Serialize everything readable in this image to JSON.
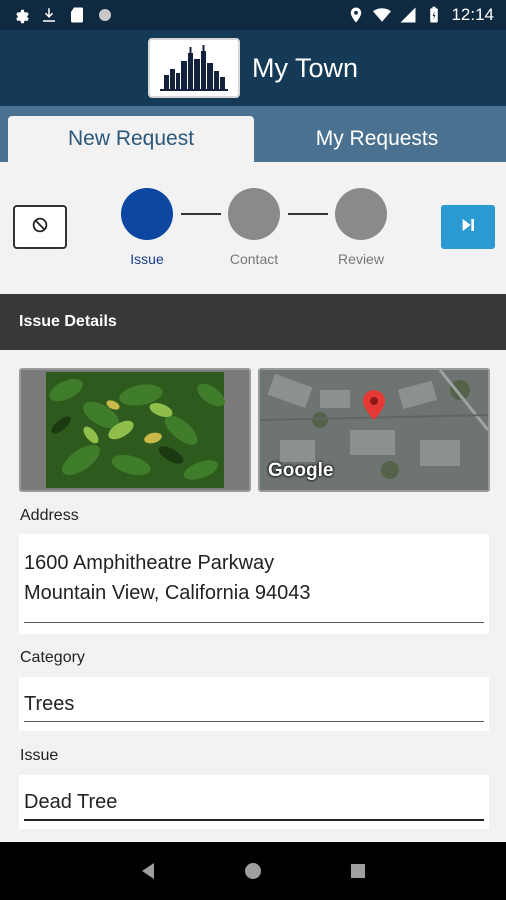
{
  "status_bar": {
    "time": "12:14",
    "left_icons": [
      "gear-icon",
      "download-icon",
      "sd-card-icon",
      "circle-icon"
    ],
    "right_icons": [
      "location-icon",
      "wifi-icon",
      "signal-icon",
      "battery-icon"
    ]
  },
  "header": {
    "title": "My Town",
    "logo": "city-skyline-logo"
  },
  "tabs": [
    {
      "label": "New Request",
      "active": true
    },
    {
      "label": "My Requests",
      "active": false
    }
  ],
  "stepper": {
    "steps": [
      {
        "label": "Issue",
        "active": true
      },
      {
        "label": "Contact",
        "active": false
      },
      {
        "label": "Review",
        "active": false
      }
    ],
    "active_color": "#0d47a1",
    "inactive_color": "#8a8a8a",
    "next_color": "#2b9ad3"
  },
  "section": {
    "title": "Issue Details"
  },
  "map": {
    "watermark": "Google",
    "pin_color": "#e53935"
  },
  "form": {
    "address_label": "Address",
    "address_line1": "1600 Amphitheatre Parkway",
    "address_line2": "Mountain View, California 94043",
    "category_label": "Category",
    "category_value": "Trees",
    "issue_label": "Issue",
    "issue_value": "Dead Tree"
  },
  "nav": {
    "icons": [
      "back-icon",
      "home-icon",
      "recents-icon"
    ]
  },
  "colors": {
    "header_bg": "#153a55",
    "status_bar_bg": "#0f2a40",
    "tabs_bg": "#4a7290",
    "section_bg": "#383838"
  }
}
